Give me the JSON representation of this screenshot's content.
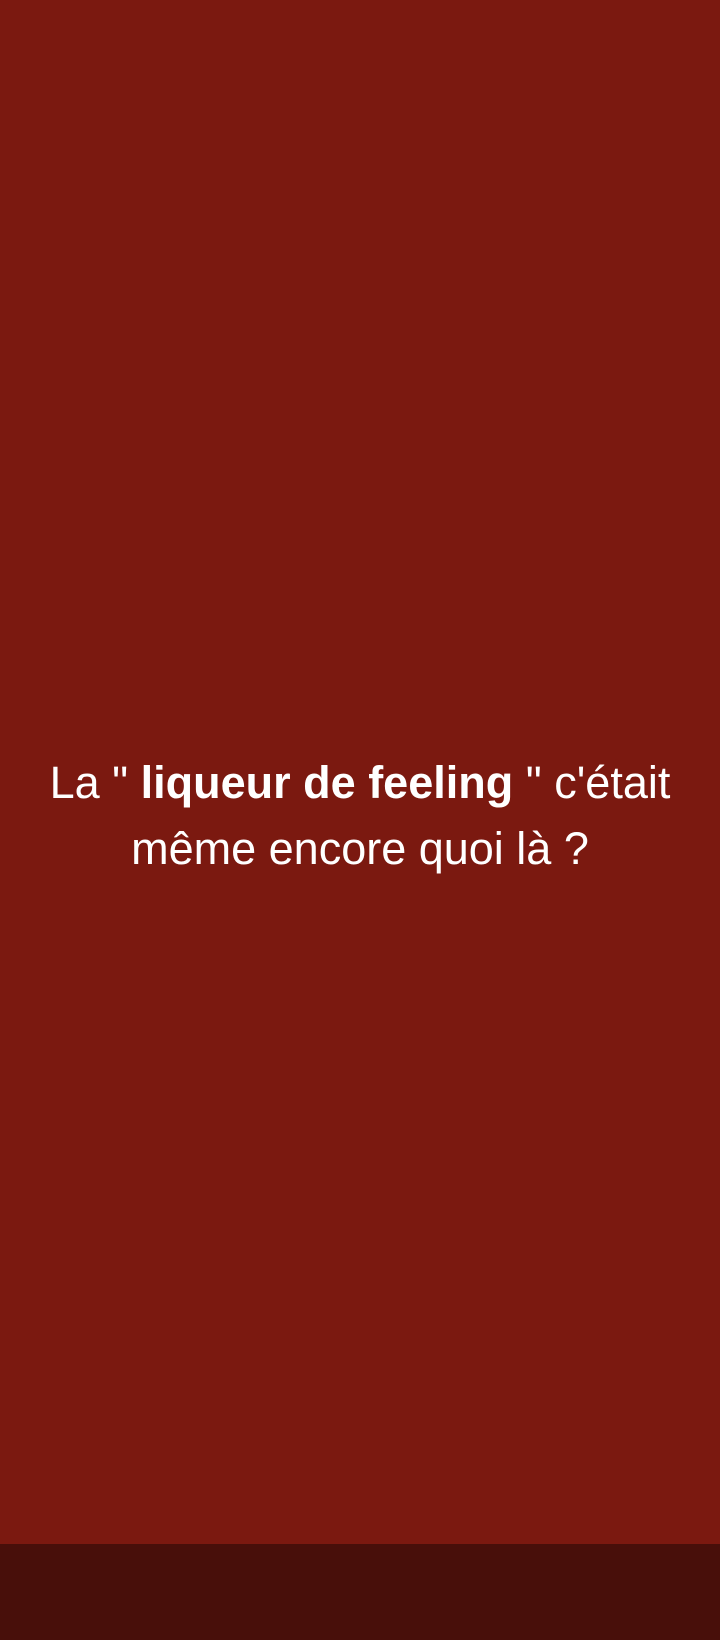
{
  "question": {
    "prefix": "La \" ",
    "highlight": "liqueur de feeling",
    "suffix": " \" c'était même encore quoi là ?"
  },
  "colors": {
    "background": "#7b1910",
    "navigation_bar": "#480f0a",
    "text": "#ffffff"
  }
}
